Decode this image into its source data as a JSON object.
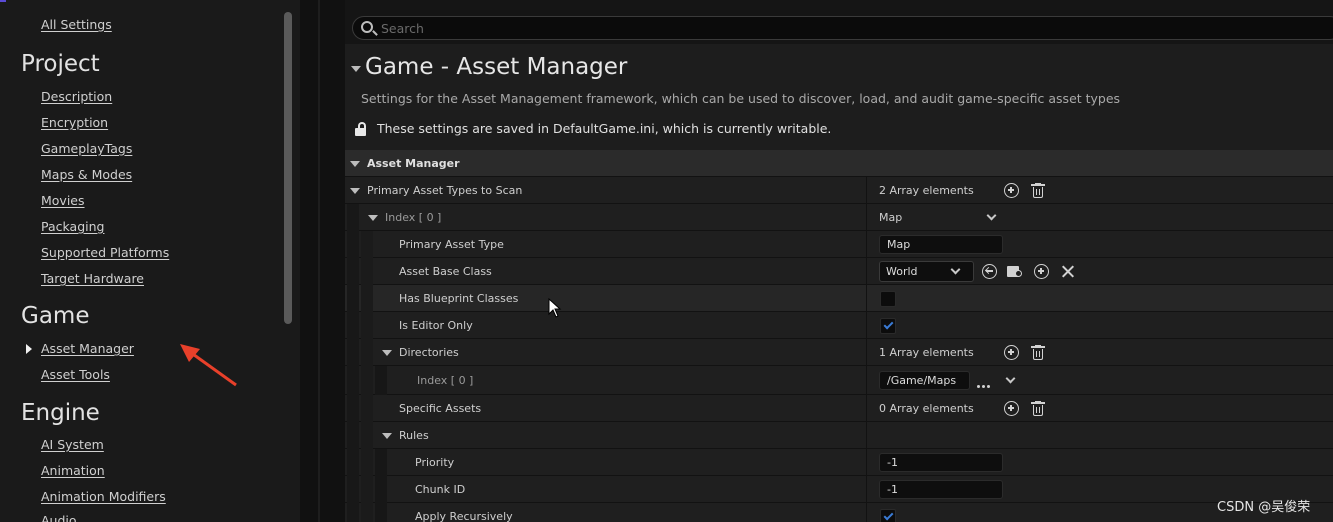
{
  "nav": {
    "all_settings": "All Settings",
    "categories": [
      {
        "title": "Project",
        "items": [
          "Description",
          "Encryption",
          "GameplayTags",
          "Maps & Modes",
          "Movies",
          "Packaging",
          "Supported Platforms",
          "Target Hardware"
        ]
      },
      {
        "title": "Game",
        "items": [
          "Asset Manager",
          "Asset Tools"
        ]
      },
      {
        "title": "Engine",
        "items": [
          "AI System",
          "Animation",
          "Animation Modifiers",
          "Audio"
        ]
      }
    ],
    "selected": "Asset Manager"
  },
  "search": {
    "placeholder": "Search"
  },
  "header": {
    "title": "Game - Asset Manager",
    "description": "Settings for the Asset Management framework, which can be used to discover, load, and audit game-specific asset types",
    "save_note": "These settings are saved in DefaultGame.ini, which is currently writable."
  },
  "grid": {
    "section": "Asset Manager",
    "primary_types_label": "Primary Asset Types to Scan",
    "primary_types_count": "2 Array elements",
    "index0_label": "Index [ 0 ]",
    "index0_value": "Map",
    "primary_asset_type_label": "Primary Asset Type",
    "primary_asset_type_value": "Map",
    "asset_base_class_label": "Asset Base Class",
    "asset_base_class_value": "World",
    "has_blueprint_label": "Has Blueprint Classes",
    "has_blueprint_checked": false,
    "is_editor_only_label": "Is Editor Only",
    "is_editor_only_checked": true,
    "directories_label": "Directories",
    "directories_count": "1 Array elements",
    "dir_index0_label": "Index [ 0 ]",
    "dir_index0_value": "/Game/Maps",
    "specific_assets_label": "Specific Assets",
    "specific_assets_count": "0 Array elements",
    "rules_label": "Rules",
    "priority_label": "Priority",
    "priority_value": "-1",
    "chunk_id_label": "Chunk ID",
    "chunk_id_value": "-1",
    "apply_recursively_label": "Apply Recursively",
    "apply_recursively_checked": true
  },
  "watermark": "CSDN @吴俊荣",
  "colors": {
    "accent_check": "#3a7bd5",
    "arrow": "#e8402a"
  }
}
